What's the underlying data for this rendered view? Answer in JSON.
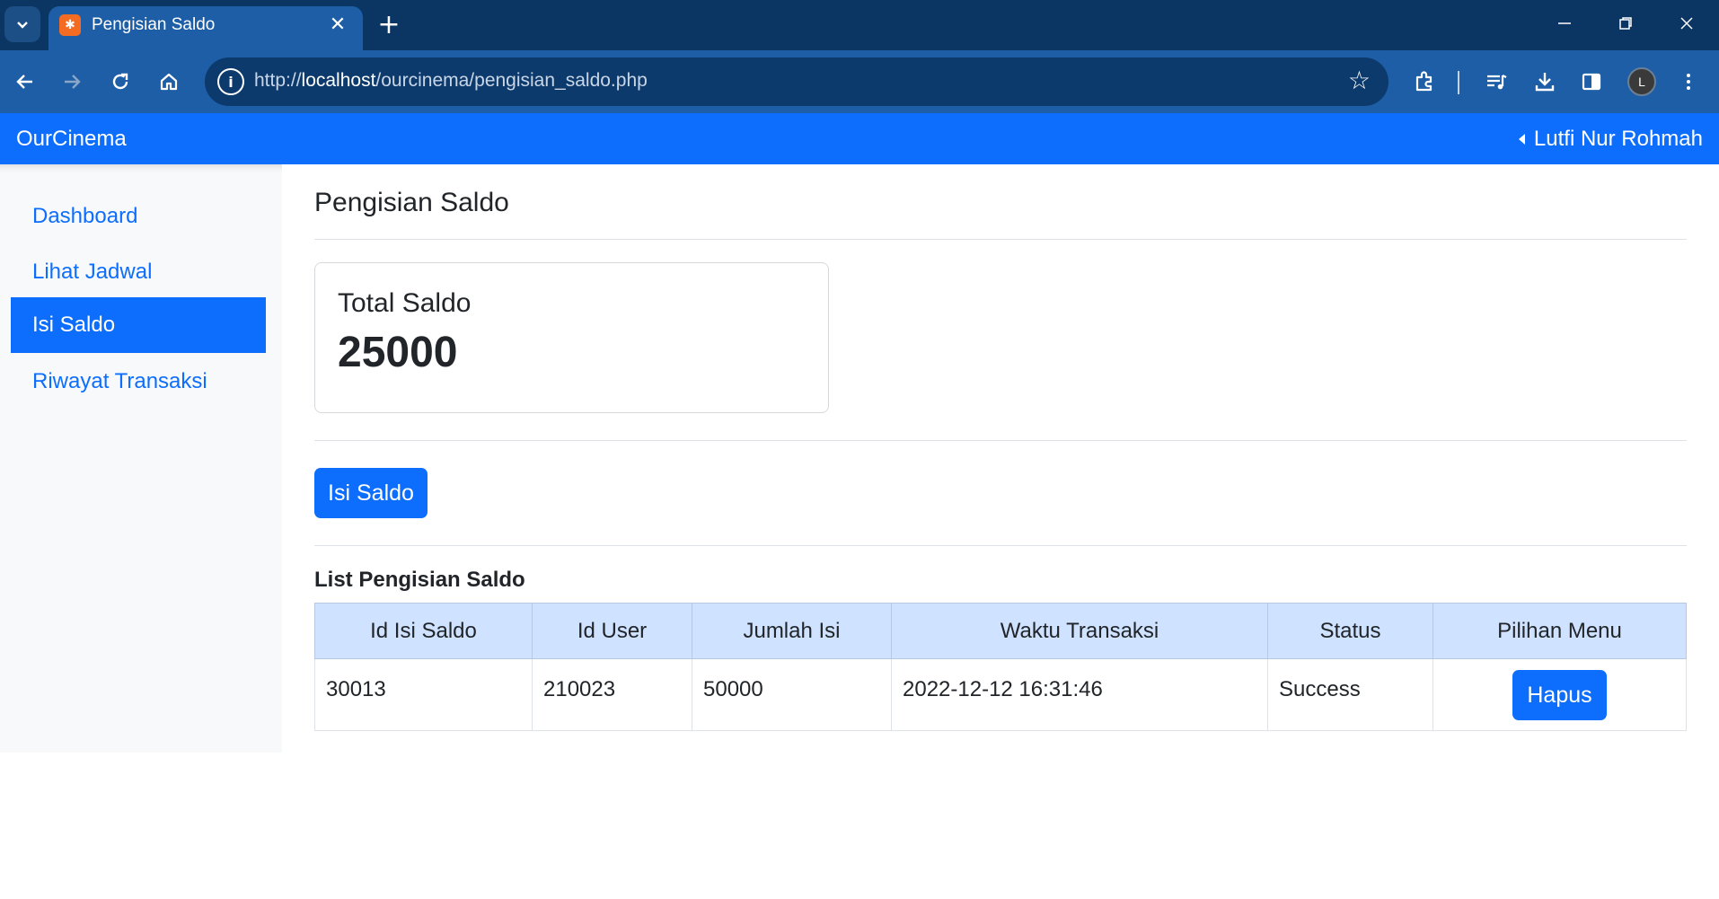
{
  "browser": {
    "tab_title": "Pengisian Saldo",
    "url_prefix": "http://",
    "url_host": "localhost",
    "url_path": "/ourcinema/pengisian_saldo.php",
    "profile_initial": "L"
  },
  "navbar": {
    "brand": "OurCinema",
    "user_name": "Lutfi Nur Rohmah"
  },
  "sidebar": {
    "items": [
      {
        "label": "Dashboard"
      },
      {
        "label": "Lihat Jadwal"
      },
      {
        "label": "Isi Saldo",
        "active": true
      },
      {
        "label": "Riwayat Transaksi"
      }
    ]
  },
  "main": {
    "title": "Pengisian Saldo",
    "saldo_card": {
      "title": "Total Saldo",
      "value": "25000"
    },
    "isi_saldo_button": "Isi Saldo",
    "list_title": "List Pengisian Saldo",
    "table": {
      "headers": [
        "Id Isi Saldo",
        "Id User",
        "Jumlah Isi",
        "Waktu Transaksi",
        "Status",
        "Pilihan Menu"
      ],
      "rows": [
        {
          "id": "30013",
          "user": "210023",
          "amount": "50000",
          "time": "2022-12-12 16:31:46",
          "status": "Success",
          "action": "Hapus"
        }
      ]
    }
  },
  "colors": {
    "primary": "#0d6efd",
    "browser_frame": "#0b3563",
    "toolbar": "#1d5ea6",
    "table_header": "#cfe2ff"
  }
}
